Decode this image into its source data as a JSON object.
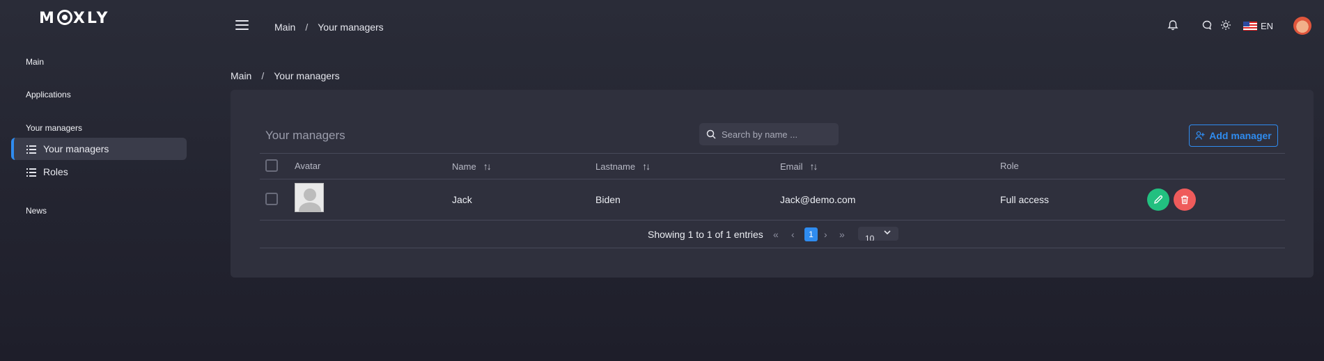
{
  "app": {
    "logo_text": [
      "M",
      "XLY"
    ]
  },
  "sidebar": {
    "sections": [
      {
        "label": "Main"
      },
      {
        "label": "Applications"
      },
      {
        "label": "Your managers"
      },
      {
        "label": "News"
      }
    ],
    "items": [
      {
        "label": "Your managers",
        "active": true,
        "icon": "list-icon"
      },
      {
        "label": "Roles",
        "active": false,
        "icon": "list-icon"
      }
    ]
  },
  "header": {
    "breadcrumb": [
      "Main",
      "Your managers"
    ],
    "separator": "/",
    "language": "EN"
  },
  "page": {
    "breadcrumb": [
      "Main",
      "Your managers"
    ],
    "separator": "/"
  },
  "table": {
    "title": "Your managers",
    "search_placeholder": "Search by name ...",
    "add_button": "Add manager",
    "columns": [
      "Avatar",
      "Name",
      "Lastname",
      "Email",
      "Role"
    ],
    "rows": [
      {
        "name": "Jack",
        "lastname": "Biden",
        "email": "Jack@demo.com",
        "role": "Full access"
      }
    ],
    "pagination": {
      "info": "Showing 1 to 1 of 1 entries",
      "current_page": "1",
      "per_page": "10",
      "first": "«",
      "prev": "‹",
      "next": "›",
      "last": "»"
    }
  },
  "colors": {
    "accent": "#2f8cf0",
    "edit": "#22c080",
    "delete": "#ef5b5b",
    "card": "#2f303d"
  }
}
